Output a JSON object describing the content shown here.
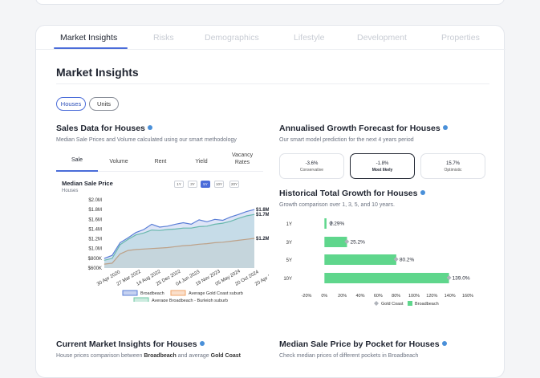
{
  "tabs": [
    "Market Insights",
    "Risks",
    "Demographics",
    "Lifestyle",
    "Development",
    "Properties"
  ],
  "page_title": "Market Insights",
  "property_types": [
    "Houses",
    "Units"
  ],
  "sales": {
    "title": "Sales Data for Houses",
    "subtitle": "Median Sale Prices and Volume calculated using our smart methodology",
    "tabs": [
      "Sale",
      "Volume",
      "Rent",
      "Yield",
      "Vacancy",
      "Rates"
    ],
    "chart_title": "Median Sale Price",
    "chart_sub": "Houses",
    "ranges": [
      "1Y",
      "3Y",
      "5Y",
      "10Y",
      "20Y"
    ]
  },
  "forecast": {
    "title": "Annualised Growth Forecast for Houses",
    "subtitle": "Our smart model prediction for the next 4 years period",
    "options": [
      {
        "value": "-3.6%",
        "label": "Conservative"
      },
      {
        "value": "-1.8%",
        "label": "Most likely"
      },
      {
        "value": "15.7%",
        "label": "Optimistic"
      }
    ]
  },
  "historical": {
    "title": "Historical Total Growth for Houses",
    "subtitle": "Growth comparison over 1, 3, 5, and 10 years."
  },
  "current": {
    "title": "Current Market Insights for Houses",
    "subtitle_prefix": "House prices comparison between ",
    "subtitle_b1": "Broadbeach",
    "subtitle_mid": " and average ",
    "subtitle_b2": "Gold Coast"
  },
  "pocket": {
    "title": "Median Sale Price by Pocket for Houses",
    "subtitle": "Check median prices of different pockets in Broadbeach"
  },
  "chart_data": [
    {
      "type": "line",
      "title": "Median Sale Price",
      "ylabel": "",
      "yticks": [
        "$2.0M",
        "$1.8M",
        "$1.6M",
        "$1.4M",
        "$1.2M",
        "$1.0M",
        "$800K",
        "$600K"
      ],
      "ylim": [
        600000,
        2000000
      ],
      "xticks": [
        "30 Apr 2020",
        "27 Mar 2022",
        "14 Aug 2022",
        "25 Dec 2022",
        "04 Jun 2023",
        "19 Nov 2023",
        "05 May 2024",
        "20 Oct 2024",
        "20 Apr 2025"
      ],
      "series": [
        {
          "name": "Broadbeach",
          "color": "#5b7fd6",
          "end_label": "$1.8M",
          "values": [
            800000,
            860000,
            1120000,
            1220000,
            1330000,
            1390000,
            1500000,
            1440000,
            1460000,
            1500000,
            1530000,
            1500000,
            1590000,
            1550000,
            1600000,
            1580000,
            1650000,
            1700000,
            1760000,
            1800000
          ]
        },
        {
          "name": "Average Broadbeach - Burleigh suburb",
          "color": "#6cc7a3",
          "end_label": "$1.7M",
          "values": [
            760000,
            800000,
            1080000,
            1190000,
            1280000,
            1320000,
            1380000,
            1370000,
            1390000,
            1400000,
            1420000,
            1420000,
            1450000,
            1460000,
            1500000,
            1520000,
            1560000,
            1620000,
            1670000,
            1700000
          ]
        },
        {
          "name": "Average Gold Coast suburb",
          "color": "#f0a46a",
          "end_label": "$1.2M",
          "values": [
            680000,
            700000,
            890000,
            960000,
            980000,
            990000,
            1000000,
            1010000,
            1020000,
            1040000,
            1060000,
            1070000,
            1090000,
            1100000,
            1120000,
            1130000,
            1150000,
            1170000,
            1190000,
            1210000
          ]
        }
      ],
      "legend": "bottom"
    },
    {
      "type": "bar",
      "orientation": "horizontal",
      "categories": [
        "1Y",
        "3Y",
        "5Y",
        "10Y"
      ],
      "xlim": [
        -20,
        160
      ],
      "xticks": [
        "-20%",
        "0%",
        "20%",
        "40%",
        "60%",
        "80%",
        "100%",
        "120%",
        "140%",
        "160%"
      ],
      "series": [
        {
          "name": "Gold Coast",
          "color": "#b0b4bb",
          "marker": "diamond",
          "values": [
            7.5,
            25,
            80,
            139
          ]
        },
        {
          "name": "Broadbeach",
          "color": "#5fd68c",
          "values": [
            2.29,
            25.2,
            80.2,
            139.0
          ]
        }
      ],
      "labels": [
        "2.29%",
        "25.2%",
        "80.2%",
        "139.0%"
      ],
      "legend": "bottom"
    }
  ]
}
